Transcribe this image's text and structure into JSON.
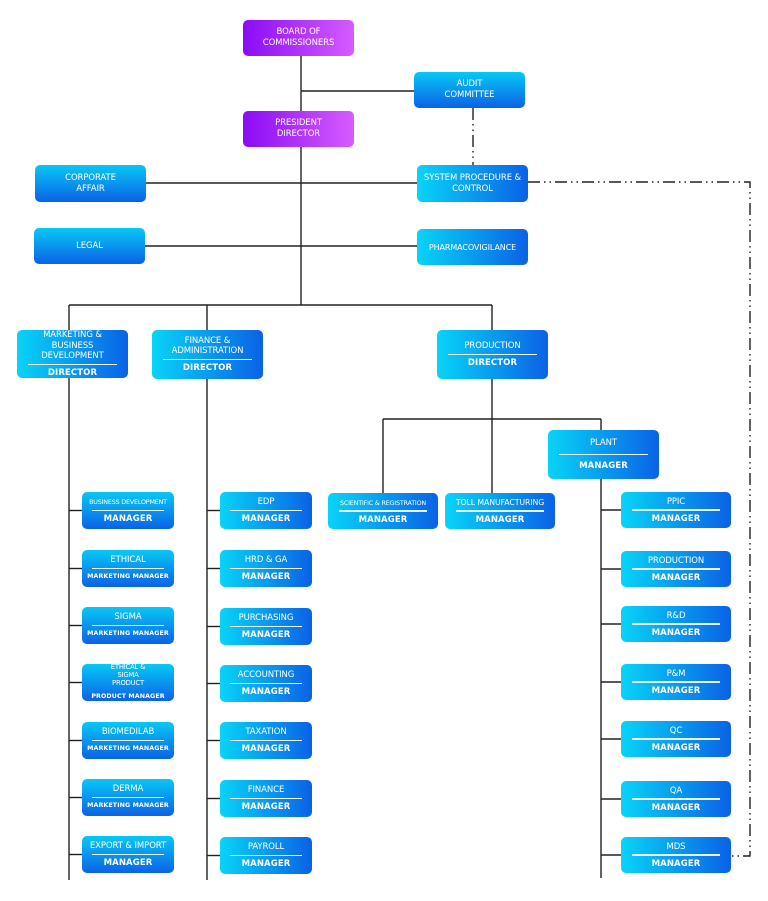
{
  "colors": {
    "executive_gradient": [
      "#8a0cf5",
      "#d65cff"
    ],
    "unit_gradient": [
      "#08d4f7",
      "#0a62e6"
    ],
    "connector": "#222222",
    "text": "#ffffff"
  },
  "executive": {
    "board": "BOARD OF COMMISSIONERS",
    "president": "PRESIDENT DIRECTOR"
  },
  "committee": {
    "audit": "AUDIT COMMITTEE"
  },
  "staff_units": {
    "corporate_affair": "CORPORATE AFFAIR",
    "legal": "LEGAL",
    "system_procedure": "SYSTEM PROCEDURE & CONTROL",
    "pharmacovigilance": "PHARMACOVIGILANCE"
  },
  "directorates": [
    {
      "name": "MARKETING & BUSINESS DEVELOPMENT",
      "role": "DIRECTOR"
    },
    {
      "name": "FINANCE & ADMINISTRATION",
      "role": "DIRECTOR"
    },
    {
      "name": "PRODUCTION",
      "role": "DIRECTOR"
    }
  ],
  "marketing_units": [
    {
      "name": "BUSINESS DEVELOPMENT",
      "role": "MANAGER"
    },
    {
      "name": "ETHICAL",
      "role": "MARKETING MANAGER"
    },
    {
      "name": "SIGMA",
      "role": "MARKETING MANAGER"
    },
    {
      "name": "ETHICAL & SIGMA PRODUCT",
      "role": "PRODUCT MANAGER"
    },
    {
      "name": "BIOMEDILAB",
      "role": "MARKETING MANAGER"
    },
    {
      "name": "DERMA",
      "role": "MARKETING MANAGER"
    },
    {
      "name": "EXPORT & IMPORT",
      "role": "MANAGER"
    }
  ],
  "finance_units": [
    {
      "name": "EDP",
      "role": "MANAGER"
    },
    {
      "name": "HRD & GA",
      "role": "MANAGER"
    },
    {
      "name": "PURCHASING",
      "role": "MANAGER"
    },
    {
      "name": "ACCOUNTING",
      "role": "MANAGER"
    },
    {
      "name": "TAXATION",
      "role": "MANAGER"
    },
    {
      "name": "FINANCE",
      "role": "MANAGER"
    },
    {
      "name": "PAYROLL",
      "role": "MANAGER"
    }
  ],
  "production_units": [
    {
      "name": "SCIENTIFIC & REGISTRATION",
      "role": "MANAGER"
    },
    {
      "name": "TOLL MANUFACTURING",
      "role": "MANAGER"
    },
    {
      "name": "PLANT",
      "role": "MANAGER"
    }
  ],
  "plant_units": [
    {
      "name": "PPIC",
      "role": "MANAGER"
    },
    {
      "name": "PRODUCTION",
      "role": "MANAGER"
    },
    {
      "name": "R&D",
      "role": "MANAGER"
    },
    {
      "name": "P&M",
      "role": "MANAGER"
    },
    {
      "name": "QC",
      "role": "MANAGER"
    },
    {
      "name": "QA",
      "role": "MANAGER"
    },
    {
      "name": "MDS",
      "role": "MANAGER"
    }
  ]
}
